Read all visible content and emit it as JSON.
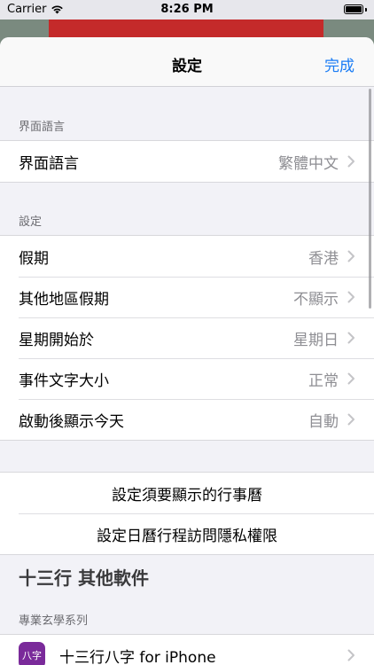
{
  "status": {
    "carrier": "Carrier",
    "time": "8:26 PM"
  },
  "nav": {
    "title": "設定",
    "done": "完成"
  },
  "language": {
    "header": "界面語言",
    "row_label": "界面語言",
    "row_value": "繁體中文"
  },
  "settings": {
    "header": "設定",
    "rows": [
      {
        "label": "假期",
        "value": "香港"
      },
      {
        "label": "其他地區假期",
        "value": "不顯示"
      },
      {
        "label": "星期開始於",
        "value": "星期日"
      },
      {
        "label": "事件文字大小",
        "value": "正常"
      },
      {
        "label": "啟動後顯示今天",
        "value": "自動"
      }
    ]
  },
  "actions": {
    "show_calendars": "設定須要顯示的行事曆",
    "calendar_privacy": "設定日曆行程訪問隱私權限"
  },
  "other_apps": {
    "title": "十三行 其他軟件",
    "subheader": "專業玄學系列",
    "apps": [
      {
        "name": "十三行八字 for iPhone",
        "icon": "bazi-app-icon",
        "icon_text": "八字",
        "icon_color": "#7a2a9a"
      }
    ]
  },
  "colors": {
    "accent": "#1a7cf5",
    "behind_red": "#c42a2a"
  }
}
